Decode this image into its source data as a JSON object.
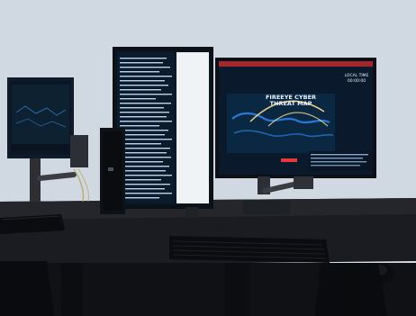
{
  "scene": {
    "right_monitor": {
      "title_lines": [
        "FIREEYE CYBER",
        "THREAT MAP"
      ],
      "local_time_lines": [
        "LOCAL TIME",
        "00:00:00"
      ]
    }
  }
}
